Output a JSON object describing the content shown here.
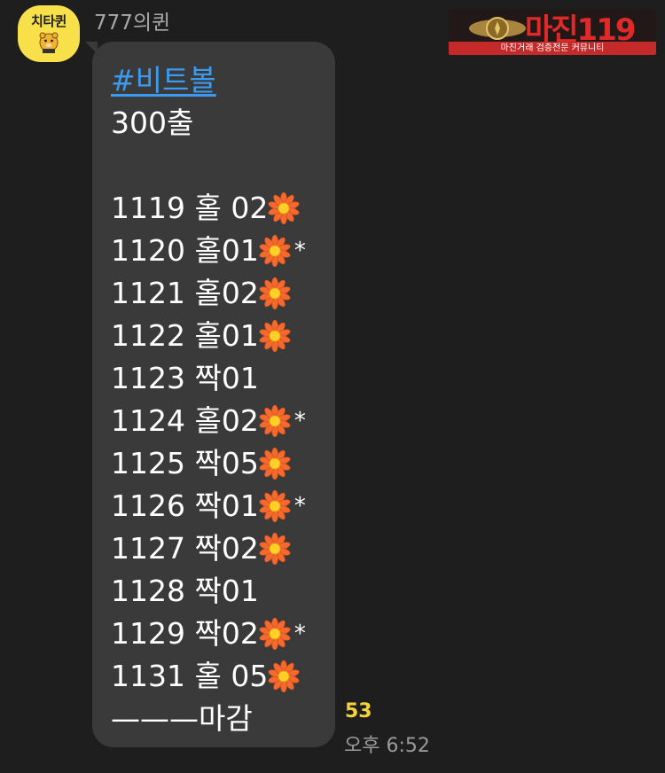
{
  "profile": {
    "avatar_text": "치타퀸",
    "sender": "777의퀸"
  },
  "watermark": {
    "title": "마진119",
    "subtitle": "마진거래 검증전문 커뮤니티"
  },
  "message": {
    "hashtag": "#비트볼",
    "amount": "300출",
    "results": [
      {
        "text": "1119 홀 02",
        "flower": true,
        "star": false
      },
      {
        "text": "1120 홀01",
        "flower": true,
        "star": true
      },
      {
        "text": "1121 홀02",
        "flower": true,
        "star": false
      },
      {
        "text": "1122 홀01",
        "flower": true,
        "star": false
      },
      {
        "text": "1123 짝01",
        "flower": false,
        "star": false
      },
      {
        "text": "1124 홀02",
        "flower": true,
        "star": true
      },
      {
        "text": "1125 짝05",
        "flower": true,
        "star": false
      },
      {
        "text": "1126 짝01",
        "flower": true,
        "star": true
      },
      {
        "text": "1127 짝02",
        "flower": true,
        "star": false
      },
      {
        "text": "1128 짝01",
        "flower": false,
        "star": false
      },
      {
        "text": "1129 짝02",
        "flower": true,
        "star": true
      },
      {
        "text": "1131 홀 05",
        "flower": true,
        "star": false
      }
    ],
    "closing": "———마감",
    "star_symbol": "*"
  },
  "meta": {
    "unread_count": "53",
    "time": "오후 6:52"
  },
  "colors": {
    "background": "#1e1e1e",
    "bubble": "#3a3a3a",
    "hashtag": "#3a9bf0",
    "unread": "#f6d23c",
    "avatar": "#f7e04a"
  }
}
